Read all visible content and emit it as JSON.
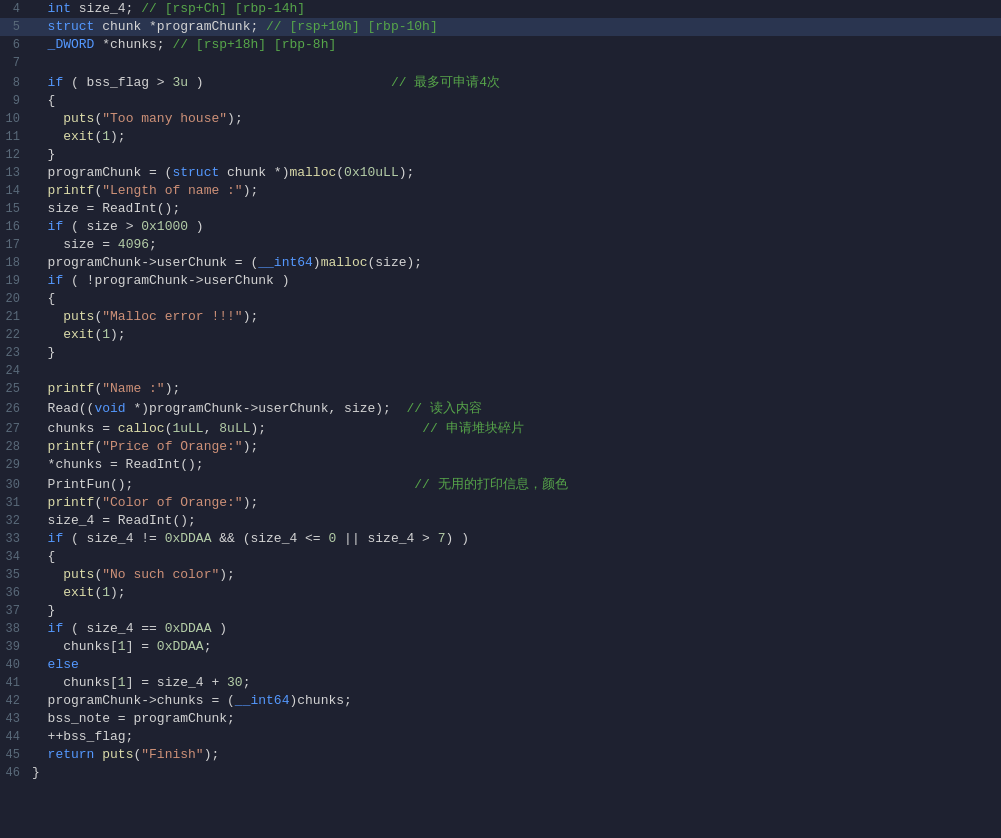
{
  "editor": {
    "background": "#1e2130",
    "lines": [
      {
        "num": 4,
        "highlighted": false,
        "tokens": [
          {
            "t": "plain",
            "v": "  "
          },
          {
            "t": "kw",
            "v": "int"
          },
          {
            "t": "plain",
            "v": " size_4; "
          },
          {
            "t": "comment",
            "v": "// [rsp+Ch] [rbp-14h]"
          }
        ]
      },
      {
        "num": 5,
        "highlighted": true,
        "tokens": [
          {
            "t": "plain",
            "v": "  "
          },
          {
            "t": "kw",
            "v": "struct"
          },
          {
            "t": "plain",
            "v": " chunk *programChunk; "
          },
          {
            "t": "comment",
            "v": "// [rsp+10h] [rbp-10h]"
          }
        ]
      },
      {
        "num": 6,
        "highlighted": false,
        "tokens": [
          {
            "t": "plain",
            "v": "  "
          },
          {
            "t": "macro",
            "v": "_DWORD"
          },
          {
            "t": "plain",
            "v": " *chunks; "
          },
          {
            "t": "comment",
            "v": "// [rsp+18h] [rbp-8h]"
          }
        ]
      },
      {
        "num": 7,
        "highlighted": false,
        "tokens": []
      },
      {
        "num": 8,
        "highlighted": false,
        "tokens": [
          {
            "t": "plain",
            "v": "  "
          },
          {
            "t": "kw",
            "v": "if"
          },
          {
            "t": "plain",
            "v": " ( bss_flag > "
          },
          {
            "t": "num",
            "v": "3u"
          },
          {
            "t": "plain",
            "v": " )                        "
          },
          {
            "t": "comment",
            "v": "// 最多可申请4次"
          }
        ]
      },
      {
        "num": 9,
        "highlighted": false,
        "tokens": [
          {
            "t": "plain",
            "v": "  {"
          }
        ]
      },
      {
        "num": 10,
        "highlighted": false,
        "tokens": [
          {
            "t": "plain",
            "v": "    "
          },
          {
            "t": "printf-fn",
            "v": "puts"
          },
          {
            "t": "plain",
            "v": "("
          },
          {
            "t": "str",
            "v": "\"Too many house\""
          },
          {
            "t": "plain",
            "v": ");"
          }
        ]
      },
      {
        "num": 11,
        "highlighted": false,
        "tokens": [
          {
            "t": "plain",
            "v": "    "
          },
          {
            "t": "printf-fn",
            "v": "exit"
          },
          {
            "t": "plain",
            "v": "("
          },
          {
            "t": "num",
            "v": "1"
          },
          {
            "t": "plain",
            "v": ");"
          }
        ]
      },
      {
        "num": 12,
        "highlighted": false,
        "tokens": [
          {
            "t": "plain",
            "v": "  }"
          }
        ]
      },
      {
        "num": 13,
        "highlighted": false,
        "tokens": [
          {
            "t": "plain",
            "v": "  programChunk = ("
          },
          {
            "t": "kw",
            "v": "struct"
          },
          {
            "t": "plain",
            "v": " chunk *)"
          },
          {
            "t": "printf-fn",
            "v": "malloc"
          },
          {
            "t": "plain",
            "v": "("
          },
          {
            "t": "hex",
            "v": "0x10uLL"
          },
          {
            "t": "plain",
            "v": ");"
          }
        ]
      },
      {
        "num": 14,
        "highlighted": false,
        "tokens": [
          {
            "t": "plain",
            "v": "  "
          },
          {
            "t": "printf-fn",
            "v": "printf"
          },
          {
            "t": "plain",
            "v": "("
          },
          {
            "t": "str",
            "v": "\"Length of name :\""
          },
          {
            "t": "plain",
            "v": ");"
          }
        ]
      },
      {
        "num": 15,
        "highlighted": false,
        "tokens": [
          {
            "t": "plain",
            "v": "  size = ReadInt();"
          }
        ]
      },
      {
        "num": 16,
        "highlighted": false,
        "tokens": [
          {
            "t": "plain",
            "v": "  "
          },
          {
            "t": "kw",
            "v": "if"
          },
          {
            "t": "plain",
            "v": " ( size > "
          },
          {
            "t": "hex",
            "v": "0x1000"
          },
          {
            "t": "plain",
            "v": " )"
          }
        ]
      },
      {
        "num": 17,
        "highlighted": false,
        "tokens": [
          {
            "t": "plain",
            "v": "    size = "
          },
          {
            "t": "num",
            "v": "4096"
          },
          {
            "t": "plain",
            "v": ";"
          }
        ]
      },
      {
        "num": 18,
        "highlighted": false,
        "tokens": [
          {
            "t": "plain",
            "v": "  programChunk->userChunk = ("
          },
          {
            "t": "macro",
            "v": "__int64"
          },
          {
            "t": "plain",
            "v": ")"
          },
          {
            "t": "printf-fn",
            "v": "malloc"
          },
          {
            "t": "plain",
            "v": "(size);"
          }
        ]
      },
      {
        "num": 19,
        "highlighted": false,
        "tokens": [
          {
            "t": "plain",
            "v": "  "
          },
          {
            "t": "kw",
            "v": "if"
          },
          {
            "t": "plain",
            "v": " ( !programChunk->userChunk )"
          }
        ]
      },
      {
        "num": 20,
        "highlighted": false,
        "tokens": [
          {
            "t": "plain",
            "v": "  {"
          }
        ]
      },
      {
        "num": 21,
        "highlighted": false,
        "tokens": [
          {
            "t": "plain",
            "v": "    "
          },
          {
            "t": "printf-fn",
            "v": "puts"
          },
          {
            "t": "plain",
            "v": "("
          },
          {
            "t": "str",
            "v": "\"Malloc error !!!\""
          },
          {
            "t": "plain",
            "v": ");"
          }
        ]
      },
      {
        "num": 22,
        "highlighted": false,
        "tokens": [
          {
            "t": "plain",
            "v": "    "
          },
          {
            "t": "printf-fn",
            "v": "exit"
          },
          {
            "t": "plain",
            "v": "("
          },
          {
            "t": "num",
            "v": "1"
          },
          {
            "t": "plain",
            "v": ");"
          }
        ]
      },
      {
        "num": 23,
        "highlighted": false,
        "tokens": [
          {
            "t": "plain",
            "v": "  }"
          }
        ]
      },
      {
        "num": 24,
        "highlighted": false,
        "tokens": []
      },
      {
        "num": 25,
        "highlighted": false,
        "tokens": [
          {
            "t": "plain",
            "v": "  "
          },
          {
            "t": "printf-fn",
            "v": "printf"
          },
          {
            "t": "plain",
            "v": "("
          },
          {
            "t": "str",
            "v": "\"Name :\""
          },
          {
            "t": "plain",
            "v": ");"
          }
        ]
      },
      {
        "num": 26,
        "highlighted": false,
        "tokens": [
          {
            "t": "plain",
            "v": "  Read(("
          },
          {
            "t": "kw",
            "v": "void"
          },
          {
            "t": "plain",
            "v": " *)programChunk->userChunk, size);  "
          },
          {
            "t": "comment",
            "v": "// 读入内容"
          }
        ]
      },
      {
        "num": 27,
        "highlighted": false,
        "tokens": [
          {
            "t": "plain",
            "v": "  chunks = "
          },
          {
            "t": "printf-fn",
            "v": "calloc"
          },
          {
            "t": "plain",
            "v": "("
          },
          {
            "t": "num",
            "v": "1uLL"
          },
          {
            "t": "plain",
            "v": ", "
          },
          {
            "t": "num",
            "v": "8uLL"
          },
          {
            "t": "plain",
            "v": ");                    "
          },
          {
            "t": "comment",
            "v": "// 申请堆块碎片"
          }
        ]
      },
      {
        "num": 28,
        "highlighted": false,
        "tokens": [
          {
            "t": "plain",
            "v": "  "
          },
          {
            "t": "printf-fn",
            "v": "printf"
          },
          {
            "t": "plain",
            "v": "("
          },
          {
            "t": "str",
            "v": "\"Price of Orange:\""
          },
          {
            "t": "plain",
            "v": ");"
          }
        ]
      },
      {
        "num": 29,
        "highlighted": false,
        "tokens": [
          {
            "t": "plain",
            "v": "  *chunks = ReadInt();"
          }
        ]
      },
      {
        "num": 30,
        "highlighted": false,
        "tokens": [
          {
            "t": "plain",
            "v": "  PrintFun();                                    "
          },
          {
            "t": "comment",
            "v": "// 无用的打印信息，颜色"
          }
        ]
      },
      {
        "num": 31,
        "highlighted": false,
        "tokens": [
          {
            "t": "plain",
            "v": "  "
          },
          {
            "t": "printf-fn",
            "v": "printf"
          },
          {
            "t": "plain",
            "v": "("
          },
          {
            "t": "str",
            "v": "\"Color of Orange:\""
          },
          {
            "t": "plain",
            "v": ");"
          }
        ]
      },
      {
        "num": 32,
        "highlighted": false,
        "tokens": [
          {
            "t": "plain",
            "v": "  size_4 = ReadInt();"
          }
        ]
      },
      {
        "num": 33,
        "highlighted": false,
        "tokens": [
          {
            "t": "plain",
            "v": "  "
          },
          {
            "t": "kw",
            "v": "if"
          },
          {
            "t": "plain",
            "v": " ( size_4 != "
          },
          {
            "t": "hex",
            "v": "0xDDAA"
          },
          {
            "t": "plain",
            "v": " && (size_4 <= "
          },
          {
            "t": "num",
            "v": "0"
          },
          {
            "t": "plain",
            "v": " || size_4 > "
          },
          {
            "t": "num",
            "v": "7"
          },
          {
            "t": "plain",
            "v": ") )"
          }
        ]
      },
      {
        "num": 34,
        "highlighted": false,
        "tokens": [
          {
            "t": "plain",
            "v": "  {"
          }
        ]
      },
      {
        "num": 35,
        "highlighted": false,
        "tokens": [
          {
            "t": "plain",
            "v": "    "
          },
          {
            "t": "printf-fn",
            "v": "puts"
          },
          {
            "t": "plain",
            "v": "("
          },
          {
            "t": "str",
            "v": "\"No such color\""
          },
          {
            "t": "plain",
            "v": ");"
          }
        ]
      },
      {
        "num": 36,
        "highlighted": false,
        "tokens": [
          {
            "t": "plain",
            "v": "    "
          },
          {
            "t": "printf-fn",
            "v": "exit"
          },
          {
            "t": "plain",
            "v": "("
          },
          {
            "t": "num",
            "v": "1"
          },
          {
            "t": "plain",
            "v": ");"
          }
        ]
      },
      {
        "num": 37,
        "highlighted": false,
        "tokens": [
          {
            "t": "plain",
            "v": "  }"
          }
        ]
      },
      {
        "num": 38,
        "highlighted": false,
        "tokens": [
          {
            "t": "plain",
            "v": "  "
          },
          {
            "t": "kw",
            "v": "if"
          },
          {
            "t": "plain",
            "v": " ( size_4 == "
          },
          {
            "t": "hex",
            "v": "0xDDAA"
          },
          {
            "t": "plain",
            "v": " )"
          }
        ]
      },
      {
        "num": 39,
        "highlighted": false,
        "tokens": [
          {
            "t": "plain",
            "v": "    chunks["
          },
          {
            "t": "num",
            "v": "1"
          },
          {
            "t": "plain",
            "v": "] = "
          },
          {
            "t": "hex",
            "v": "0xDDAA"
          },
          {
            "t": "plain",
            "v": ";"
          }
        ]
      },
      {
        "num": 40,
        "highlighted": false,
        "tokens": [
          {
            "t": "plain",
            "v": "  "
          },
          {
            "t": "kw",
            "v": "else"
          }
        ]
      },
      {
        "num": 41,
        "highlighted": false,
        "tokens": [
          {
            "t": "plain",
            "v": "    chunks["
          },
          {
            "t": "num",
            "v": "1"
          },
          {
            "t": "plain",
            "v": "] = size_4 + "
          },
          {
            "t": "num",
            "v": "30"
          },
          {
            "t": "plain",
            "v": ";"
          }
        ]
      },
      {
        "num": 42,
        "highlighted": false,
        "tokens": [
          {
            "t": "plain",
            "v": "  programChunk->chunks = ("
          },
          {
            "t": "macro",
            "v": "__int64"
          },
          {
            "t": "plain",
            "v": ")chunks;"
          }
        ]
      },
      {
        "num": 43,
        "highlighted": false,
        "tokens": [
          {
            "t": "plain",
            "v": "  bss_note = programChunk;"
          }
        ]
      },
      {
        "num": 44,
        "highlighted": false,
        "tokens": [
          {
            "t": "plain",
            "v": "  ++bss_flag;"
          }
        ]
      },
      {
        "num": 45,
        "highlighted": false,
        "tokens": [
          {
            "t": "plain",
            "v": "  "
          },
          {
            "t": "kw",
            "v": "return"
          },
          {
            "t": "plain",
            "v": " "
          },
          {
            "t": "printf-fn",
            "v": "puts"
          },
          {
            "t": "plain",
            "v": "("
          },
          {
            "t": "str",
            "v": "\"Finish\""
          },
          {
            "t": "plain",
            "v": ");"
          }
        ]
      },
      {
        "num": 46,
        "highlighted": false,
        "tokens": [
          {
            "t": "plain",
            "v": "}"
          }
        ]
      }
    ]
  }
}
